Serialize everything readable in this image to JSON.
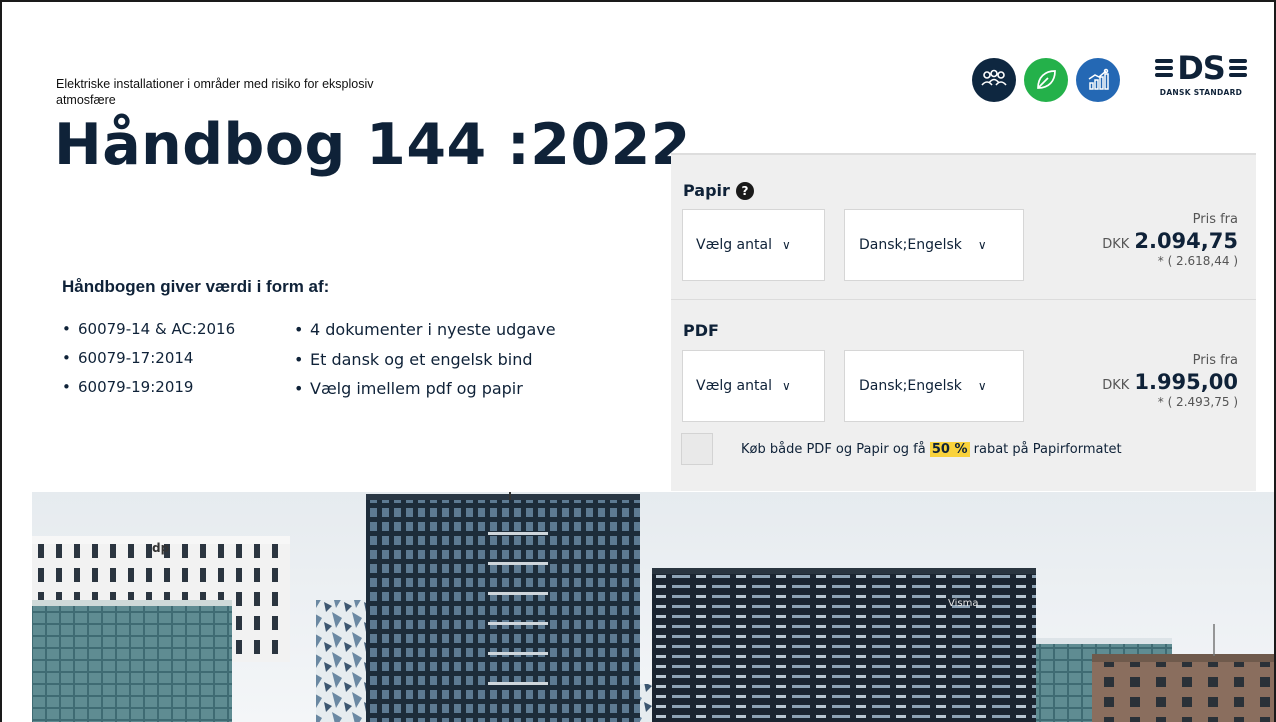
{
  "header": {
    "subtitle": "Elektriske installationer i områder med risiko for eksplosiv atmosfære",
    "title": "Håndbog 144 :2022"
  },
  "logo": {
    "text": "DS",
    "subtext": "DANSK STANDARD"
  },
  "icons": [
    {
      "name": "people-icon",
      "color": "#0e2740"
    },
    {
      "name": "leaf-icon",
      "color": "#24b14a"
    },
    {
      "name": "growth-chart-icon",
      "color": "#2468b4"
    }
  ],
  "value": {
    "heading": "Håndbogen giver værdi i form af:",
    "col1": [
      "60079-14 & AC:2016",
      "60079-17:2014",
      "60079-19:2019"
    ],
    "col2": [
      "4 dokumenter i nyeste udgave",
      "Et dansk og et engelsk bind",
      "Vælg imellem pdf og papir"
    ]
  },
  "purchase": {
    "paper": {
      "label": "Papir",
      "help": "?",
      "quantity_label": "Vælg antal",
      "language_label": "Dansk;Engelsk",
      "price_from": "Pris fra",
      "currency": "DKK",
      "price": "2.094,75",
      "price_incl": "* ( 2.618,44 )"
    },
    "pdf": {
      "label": "PDF",
      "quantity_label": "Vælg antal",
      "language_label": "Dansk;Engelsk",
      "price_from": "Pris fra",
      "currency": "DKK",
      "price": "1.995,00",
      "price_incl": "* ( 2.493,75 )"
    },
    "bundle": {
      "text_before": "Køb både PDF og Papir og få ",
      "highlight": "50 %",
      "text_after": " rabat på Papirformatet",
      "highlight_color": "#f9d23c"
    }
  },
  "photo": {
    "building_signs": [
      "dp",
      "Visma"
    ]
  }
}
